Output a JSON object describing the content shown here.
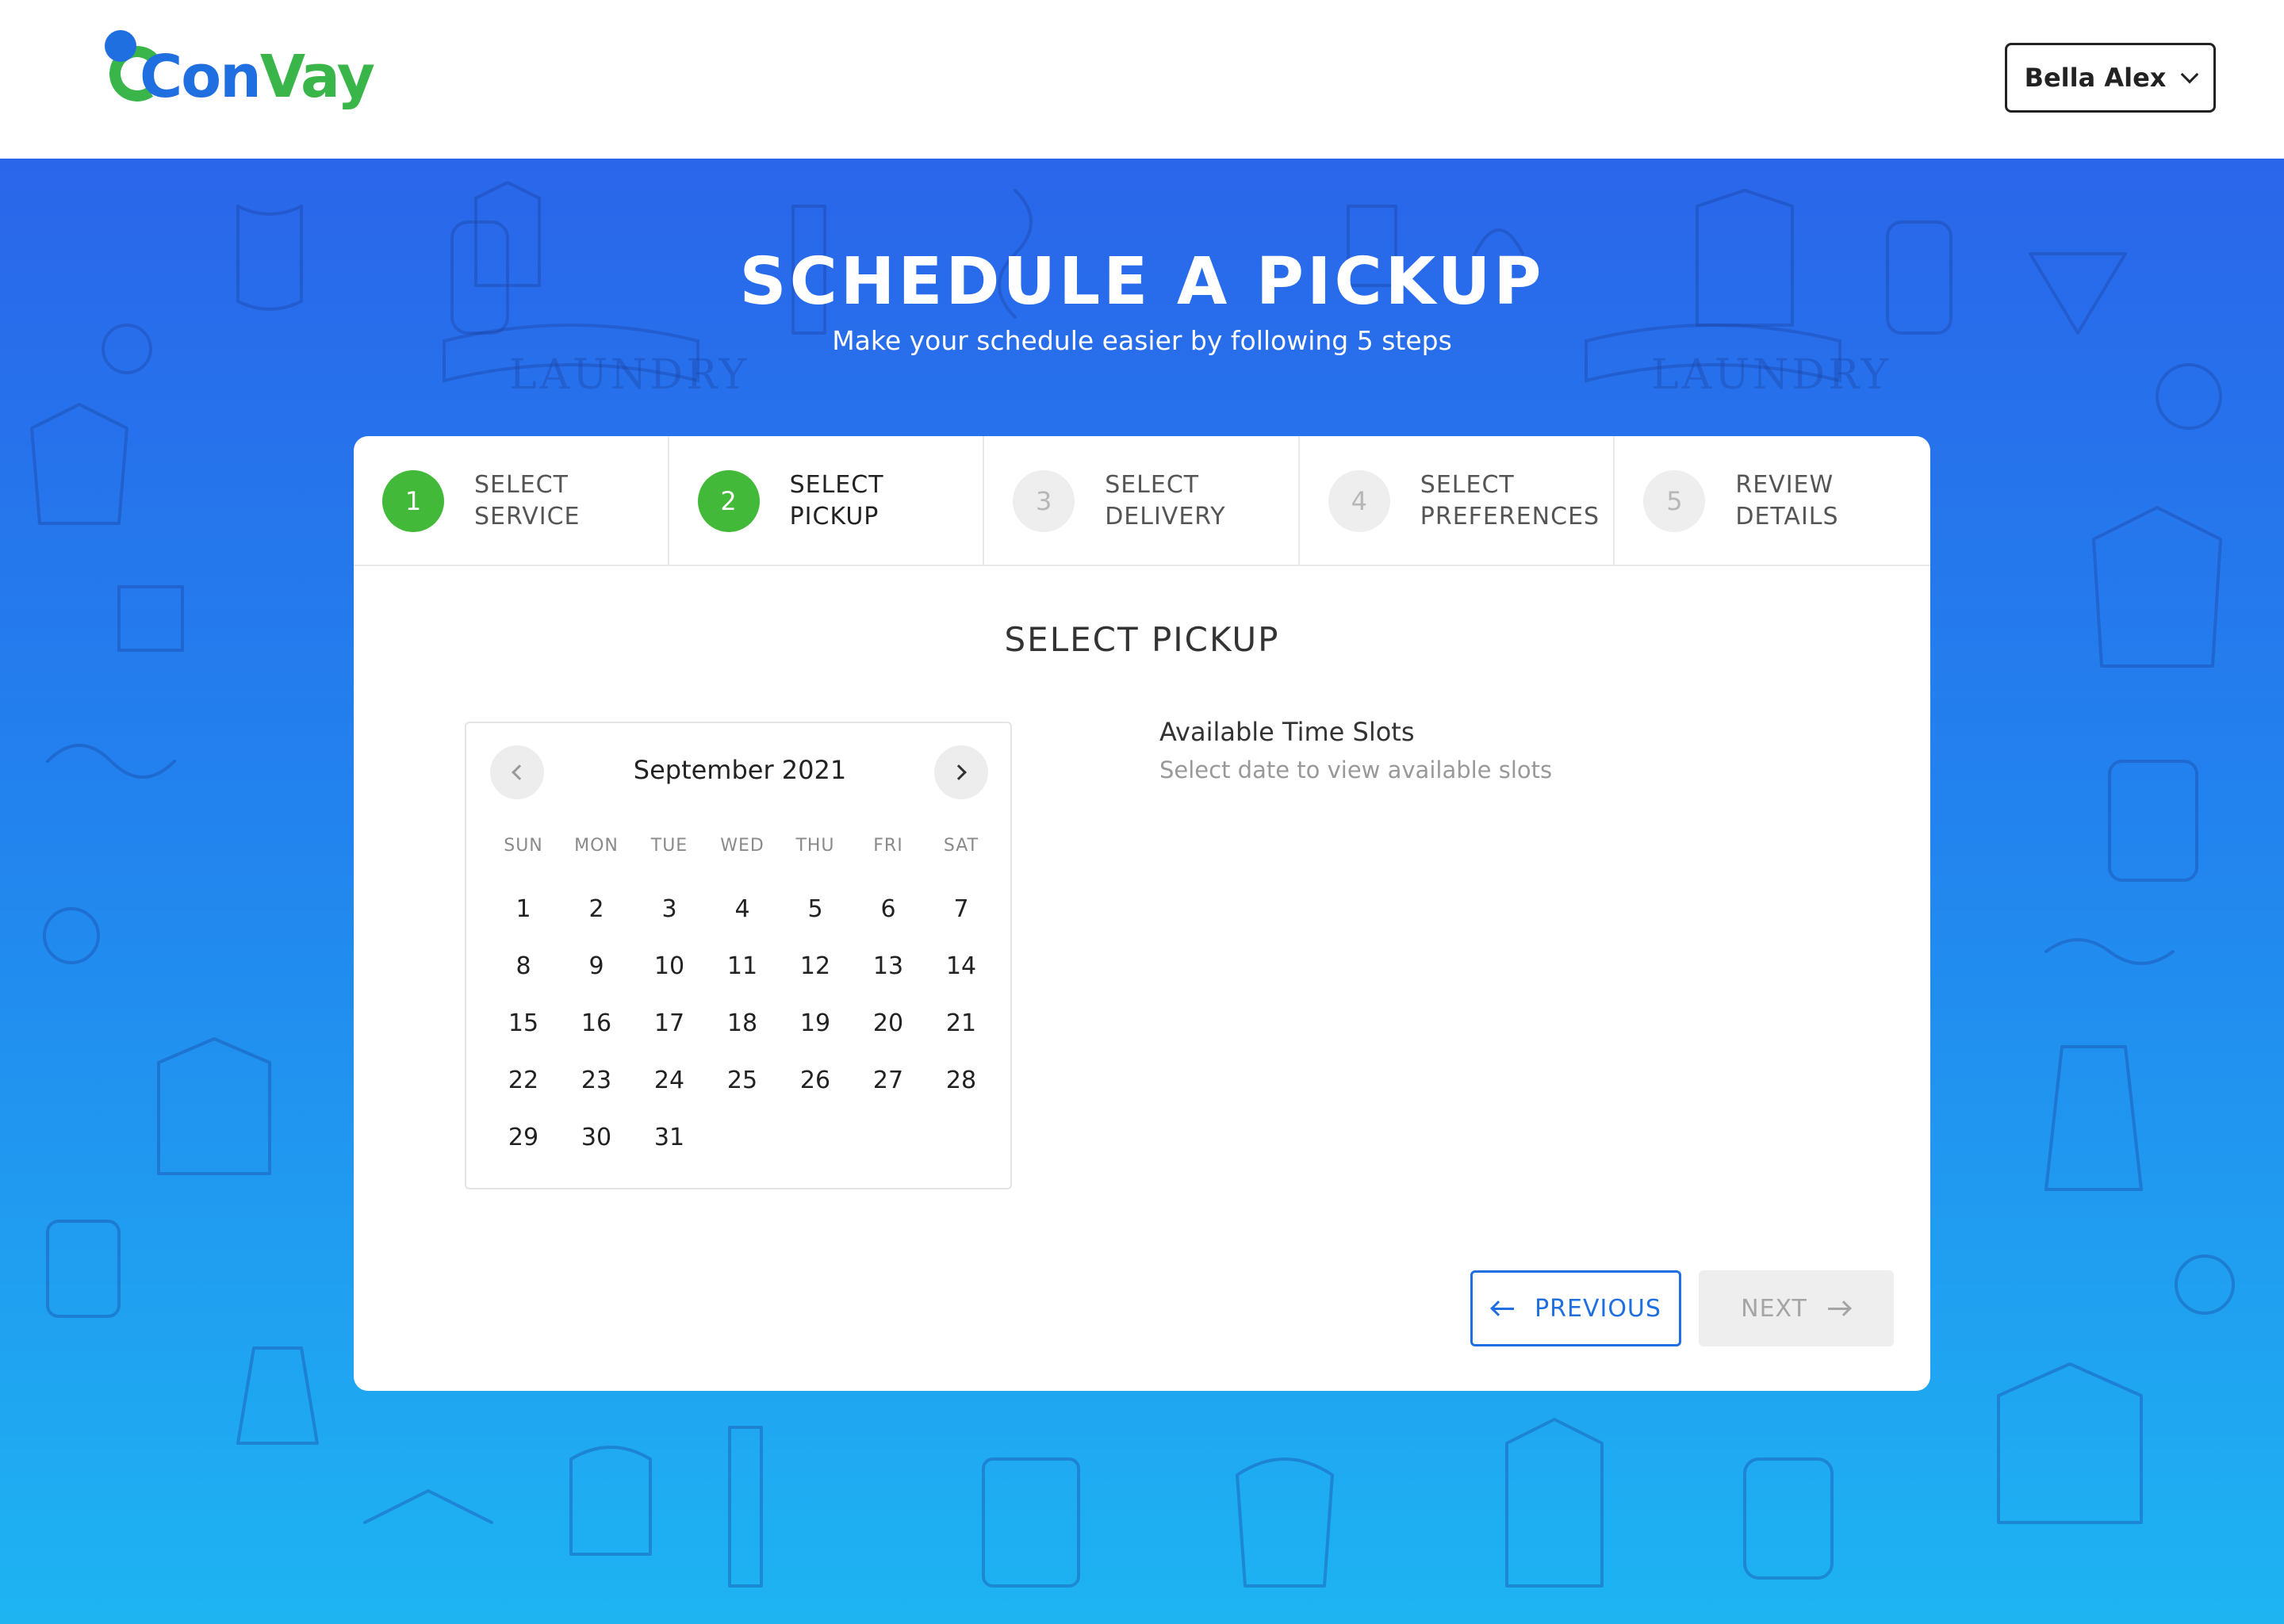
{
  "header": {
    "logo": {
      "part1": "Con",
      "part2": "Vay"
    },
    "user_name": "Bella Alex",
    "user_menu_icon": "chevron-down-icon"
  },
  "hero": {
    "title": "SCHEDULE A PICKUP",
    "subtitle": "Make your schedule easier by following 5 steps",
    "background_pattern_text": [
      "LAUNDRY",
      "LAUNDRY"
    ]
  },
  "steps": [
    {
      "number": "1",
      "line1": "SELECT",
      "line2": "SERVICE",
      "state": "complete"
    },
    {
      "number": "2",
      "line1": "SELECT",
      "line2": "PICKUP",
      "state": "current"
    },
    {
      "number": "3",
      "line1": "SELECT",
      "line2": "DELIVERY",
      "state": "upcoming"
    },
    {
      "number": "4",
      "line1": "SELECT",
      "line2": "PREFERENCES",
      "state": "upcoming"
    },
    {
      "number": "5",
      "line1": "REVIEW",
      "line2": "DETAILS",
      "state": "upcoming"
    }
  ],
  "section_title": "SELECT PICKUP",
  "calendar": {
    "month_label": "September 2021",
    "weekdays": [
      "SUN",
      "MON",
      "TUE",
      "WED",
      "THU",
      "FRI",
      "SAT"
    ],
    "days": [
      "1",
      "2",
      "3",
      "4",
      "5",
      "6",
      "7",
      "8",
      "9",
      "10",
      "11",
      "12",
      "13",
      "14",
      "15",
      "16",
      "17",
      "18",
      "19",
      "20",
      "21",
      "22",
      "23",
      "24",
      "25",
      "26",
      "27",
      "28",
      "29",
      "30",
      "31"
    ],
    "prev_icon": "chevron-left-icon",
    "next_icon": "chevron-right-icon"
  },
  "time_slots": {
    "title": "Available Time Slots",
    "hint": "Select date to view available slots"
  },
  "buttons": {
    "previous": "PREVIOUS",
    "next": "NEXT"
  },
  "colors": {
    "brand_blue": "#1f6fe0",
    "brand_green": "#3ab54a",
    "step_complete": "#43b93a",
    "hero_top": "#2a66ea",
    "hero_bottom": "#1eb4f2"
  }
}
